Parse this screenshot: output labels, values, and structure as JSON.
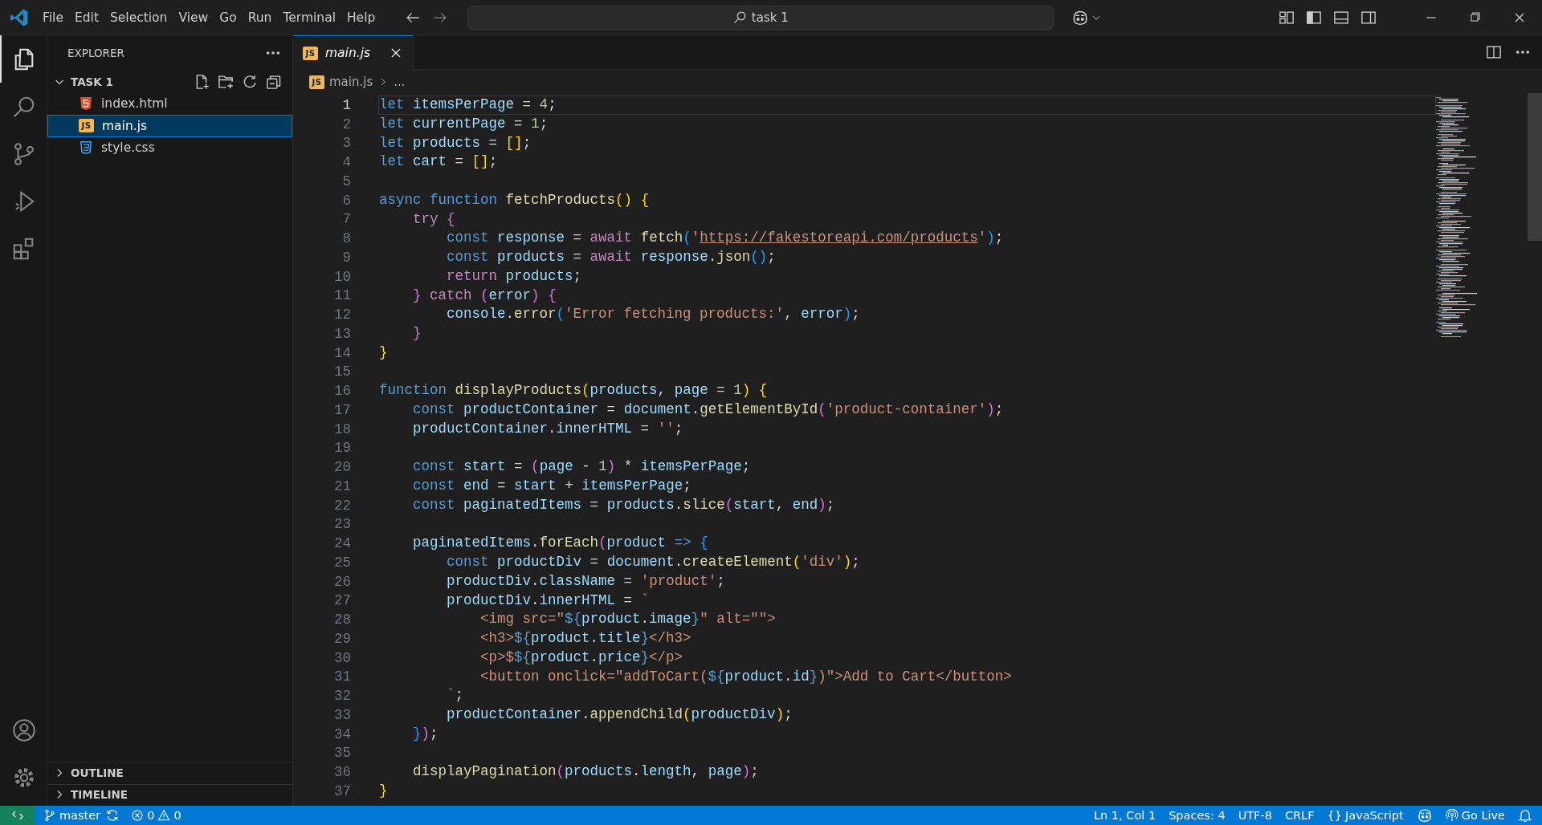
{
  "title_bar": {
    "menu": [
      "File",
      "Edit",
      "Selection",
      "View",
      "Go",
      "Run",
      "Terminal",
      "Help"
    ],
    "command_center": "task 1"
  },
  "activity_bar": {
    "items": [
      {
        "kind": "explorer",
        "selected": true
      },
      {
        "kind": "search",
        "selected": false
      },
      {
        "kind": "source-control",
        "selected": false
      },
      {
        "kind": "run",
        "selected": false
      },
      {
        "kind": "extensions",
        "selected": false
      }
    ],
    "bottom": [
      {
        "kind": "account"
      },
      {
        "kind": "settings"
      }
    ]
  },
  "sidebar": {
    "title": "EXPLORER",
    "folder": {
      "name": "TASK 1",
      "expanded": true,
      "files": [
        {
          "name": "index.html",
          "kind": "html",
          "selected": false
        },
        {
          "name": "main.js",
          "kind": "js",
          "icon_text": "JS",
          "selected": true
        },
        {
          "name": "style.css",
          "kind": "css",
          "selected": false
        }
      ]
    },
    "sections": [
      {
        "name": "OUTLINE",
        "expanded": false
      },
      {
        "name": "TIMELINE",
        "expanded": false
      }
    ]
  },
  "editor": {
    "tabs": [
      {
        "name": "main.js",
        "kind": "js",
        "icon_text": "JS",
        "selected": true,
        "preview": true
      }
    ],
    "breadcrumb": [
      {
        "name": "main.js",
        "kind": "js",
        "icon_text": "JS"
      },
      {
        "name": "..."
      }
    ],
    "lines": [
      {
        "number": "1",
        "code": "let itemsPerPage = 4;",
        "current": true
      },
      {
        "number": "2",
        "code": "let currentPage = 1;",
        "current": false
      },
      {
        "number": "3",
        "code": "let products = [];",
        "current": false
      },
      {
        "number": "4",
        "code": "let cart = [];",
        "current": false
      },
      {
        "number": "5",
        "current": false
      },
      {
        "number": "6",
        "code": "async function fetchProducts() {",
        "current": false
      },
      {
        "number": "7",
        "code": "    try {",
        "current": false
      },
      {
        "number": "8",
        "code": "        const response = await fetch('https://fakestoreapi.com/products');",
        "current": false
      },
      {
        "number": "9",
        "code": "        const products = await response.json();",
        "current": false
      },
      {
        "number": "10",
        "code": "        return products;",
        "current": false
      },
      {
        "number": "11",
        "code": "    } catch (error) {",
        "current": false
      },
      {
        "number": "12",
        "code": "        console.error('Error fetching products:', error);",
        "current": false
      },
      {
        "number": "13",
        "code": "    }",
        "current": false
      },
      {
        "number": "14",
        "code": "}",
        "current": false
      },
      {
        "number": "15",
        "current": false
      },
      {
        "number": "16",
        "code": "function displayProducts(products, page = 1) {",
        "current": false
      },
      {
        "number": "17",
        "code": "    const productContainer = document.getElementById('product-container');",
        "current": false
      },
      {
        "number": "18",
        "code": "    productContainer.innerHTML = '';",
        "current": false
      },
      {
        "number": "19",
        "current": false
      },
      {
        "number": "20",
        "code": "    const start = (page - 1) * itemsPerPage;",
        "current": false
      },
      {
        "number": "21",
        "code": "    const end = start + itemsPerPage;",
        "current": false
      },
      {
        "number": "22",
        "code": "    const paginatedItems = products.slice(start, end);",
        "current": false
      },
      {
        "number": "23",
        "current": false
      },
      {
        "number": "24",
        "code": "    paginatedItems.forEach(product => {",
        "current": false
      },
      {
        "number": "25",
        "code": "        const productDiv = document.createElement('div');",
        "current": false
      },
      {
        "number": "26",
        "code": "        productDiv.className = 'product';",
        "current": false
      },
      {
        "number": "27",
        "code": "        productDiv.innerHTML = `",
        "current": false
      },
      {
        "number": "28",
        "code": "            <img src=\"${product.image}\" alt=\"\">",
        "current": false
      },
      {
        "number": "29",
        "code": "            <h3>${product.title}</h3>",
        "current": false
      },
      {
        "number": "30",
        "code": "            <p>$${product.price}</p>",
        "current": false
      },
      {
        "number": "31",
        "code": "            <button onclick=\"addToCart(${product.id})\">Add to Cart</button>",
        "current": false
      },
      {
        "number": "32",
        "code": "        `;",
        "current": false
      },
      {
        "number": "33",
        "code": "        productContainer.appendChild(productDiv);",
        "current": false
      },
      {
        "number": "34",
        "code": "    });",
        "current": false
      },
      {
        "number": "35",
        "current": false
      },
      {
        "number": "36",
        "code": "    displayPagination(products.length, page);",
        "current": false
      },
      {
        "number": "37",
        "code": "}",
        "current": false
      }
    ]
  },
  "status_bar": {
    "left": [
      {
        "kind": "remote"
      },
      {
        "kind": "branch",
        "text": "master"
      },
      {
        "kind": "sync"
      },
      {
        "kind": "errors",
        "text": "0"
      },
      {
        "kind": "warnings",
        "text": "0"
      }
    ],
    "right": [
      {
        "kind": "text",
        "text": "Ln 1, Col 1"
      },
      {
        "kind": "text",
        "text": "Spaces: 4"
      },
      {
        "kind": "text",
        "text": "UTF-8"
      },
      {
        "kind": "text",
        "text": "CRLF"
      },
      {
        "kind": "language",
        "icon": "{}",
        "text": "JavaScript"
      },
      {
        "kind": "copilot"
      },
      {
        "kind": "live",
        "text": "Go Live"
      },
      {
        "kind": "bell"
      }
    ]
  }
}
